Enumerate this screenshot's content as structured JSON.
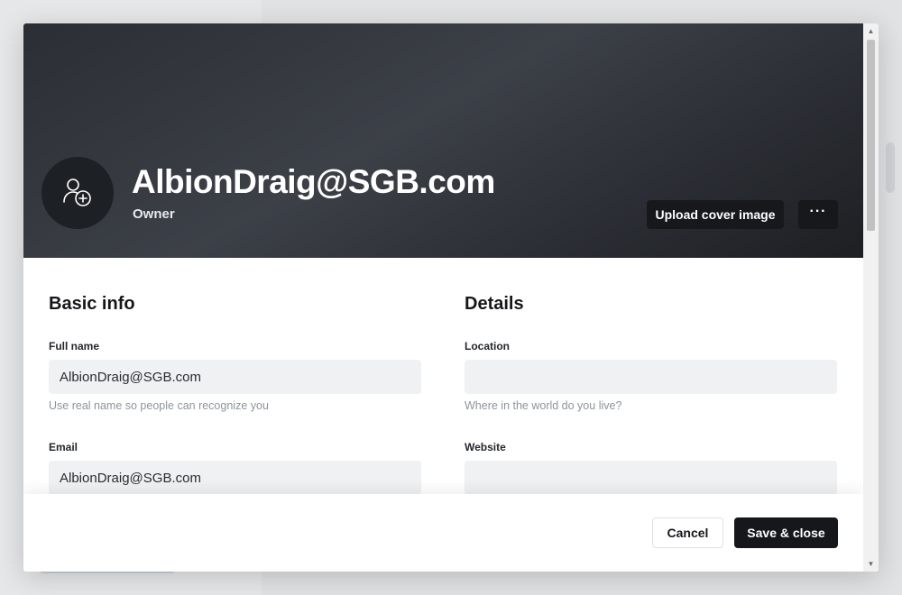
{
  "profile": {
    "name": "AlbionDraig@SGB.com",
    "role": "Owner",
    "avatar_icon": "add-user-icon"
  },
  "cover_actions": {
    "upload_label": "Upload cover image",
    "more_label": "···"
  },
  "basic_info": {
    "title": "Basic info",
    "full_name_label": "Full name",
    "full_name_value": "AlbionDraig@SGB.com",
    "full_name_hint": "Use real name so people can recognize you",
    "email_label": "Email",
    "email_value": "AlbionDraig@SGB.com"
  },
  "details": {
    "title": "Details",
    "location_label": "Location",
    "location_value": "",
    "location_hint": "Where in the world do you live?",
    "website_label": "Website",
    "website_value": ""
  },
  "footer": {
    "cancel_label": "Cancel",
    "save_label": "Save & close"
  },
  "colors": {
    "cover_dark": "#2b2e34",
    "button_dark": "#15171a",
    "input_bg": "#eff1f2"
  }
}
